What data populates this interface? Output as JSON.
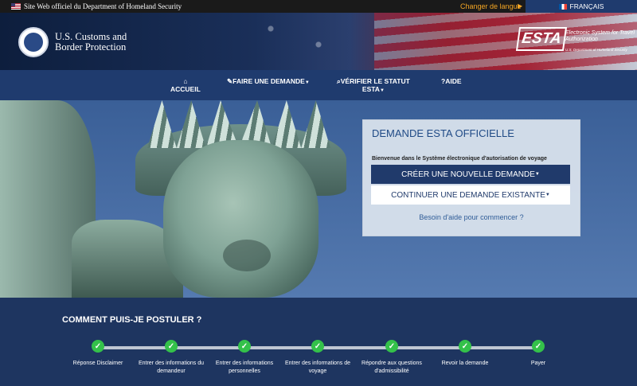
{
  "topbar": {
    "official_site": "Site Web officiel du Department of Homeland Security",
    "change_language": "Changer de langue",
    "current_language": "FRANÇAIS"
  },
  "header": {
    "agency_name": "U.S. Customs and Border Protection",
    "esta_logo_text": "ESTA",
    "esta_subtitle": "Electronic System for Travel Authorization",
    "esta_dept": "U.S. Department of Homeland Security"
  },
  "nav": {
    "home": "ACCUEIL",
    "apply": "FAIRE UNE DEMANDE",
    "check_status_1": "VÉRIFIER LE STATUT",
    "check_status_2": "ESTA",
    "help": "AIDE"
  },
  "panel": {
    "title": "DEMANDE ESTA OFFICIELLE",
    "subtitle": "Bienvenue dans le Système électronique d'autorisation de voyage",
    "new_application": "CRÉER UNE NOUVELLE DEMANDE",
    "continue_application": "CONTINUER UNE DEMANDE EXISTANTE",
    "help_link": "Besoin d'aide pour commencer ?"
  },
  "steps": {
    "title": "COMMENT PUIS-JE POSTULER ?",
    "items": [
      {
        "label": "Réponse Disclaimer",
        "status": "complete"
      },
      {
        "label": "Entrer des informations du demandeur",
        "status": "complete"
      },
      {
        "label": "Entrer des informations personnelles",
        "status": "complete"
      },
      {
        "label": "Entrer des informations de voyage",
        "status": "complete"
      },
      {
        "label": "Répondre aux questions d'admissibilité",
        "status": "complete"
      },
      {
        "label": "Revoir la demande",
        "status": "complete"
      },
      {
        "label": "Payer",
        "status": "complete"
      }
    ]
  },
  "colors": {
    "nav_bg": "#1f3b6e",
    "accent_orange": "#f5a623",
    "step_green": "#34c14a",
    "primary_button": "#203a6b"
  }
}
